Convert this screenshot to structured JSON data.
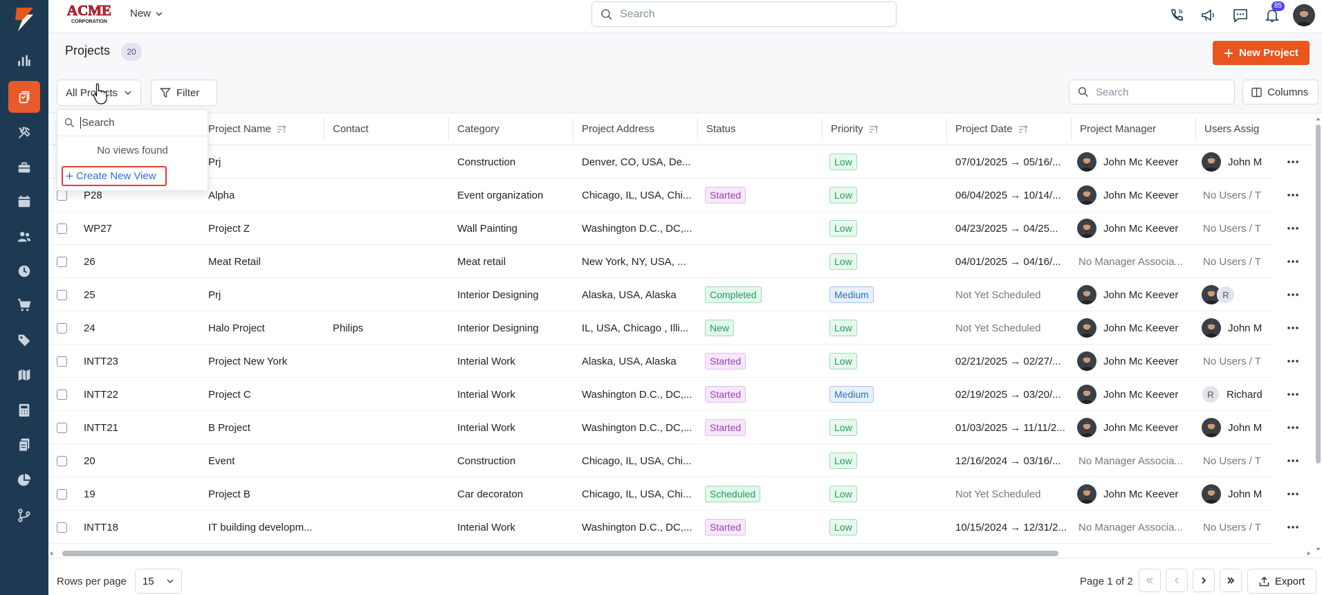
{
  "app": {
    "brand_name": "ACME",
    "brand_sub": "CORPORATION",
    "new_menu": "New",
    "search_placeholder": "Search",
    "notification_count": "85",
    "accent": "#e8551f",
    "sidebar_color": "#1e3a52"
  },
  "sidebar": {
    "items": [
      {
        "icon": "bar-chart-icon"
      },
      {
        "icon": "projects-icon",
        "active": true
      },
      {
        "icon": "tools-icon"
      },
      {
        "icon": "briefcase-icon"
      },
      {
        "icon": "calendar-icon"
      },
      {
        "icon": "users-icon"
      },
      {
        "icon": "clock-icon"
      },
      {
        "icon": "cart-icon"
      },
      {
        "icon": "tag-icon"
      },
      {
        "icon": "map-icon"
      },
      {
        "icon": "calculator-icon"
      },
      {
        "icon": "documents-icon"
      },
      {
        "icon": "pie-chart-icon"
      },
      {
        "icon": "workflow-icon"
      }
    ]
  },
  "page": {
    "title": "Projects",
    "count": "20",
    "new_project_label": "New Project"
  },
  "toolbar": {
    "view_label": "All Projects",
    "filter_label": "Filter",
    "search_placeholder": "Search",
    "columns_label": "Columns"
  },
  "views_dropdown": {
    "search_placeholder": "Search",
    "empty_text": "No views found",
    "create_label": "Create New View"
  },
  "table": {
    "columns": [
      "Project Name",
      "Contact",
      "Category",
      "Project Address",
      "Status",
      "Priority",
      "Project Date",
      "Project Manager",
      "Users Assig"
    ],
    "rows": [
      {
        "id": "",
        "name": "Prj",
        "contact": "",
        "category": "Construction",
        "address": "Denver, CO, USA, De...",
        "status": "",
        "priority": "Low",
        "date": "07/01/2025 → 05/16/...",
        "manager": "John Mc Keever",
        "users": "John M",
        "users_type": "avatar"
      },
      {
        "id": "P28",
        "name": "Alpha",
        "contact": "",
        "category": "Event organization",
        "address": "Chicago, IL, USA, Chi...",
        "status": "Started",
        "priority": "Low",
        "date": "06/04/2025 → 10/14/...",
        "manager": "John Mc Keever",
        "users": "No Users / T",
        "users_type": "none"
      },
      {
        "id": "WP27",
        "name": "Project Z",
        "contact": "",
        "category": "Wall Painting",
        "address": "Washington D.C., DC,...",
        "status": "",
        "priority": "Low",
        "date": "04/23/2025 → 04/25...",
        "manager": "John Mc Keever",
        "users": "No Users / T",
        "users_type": "none"
      },
      {
        "id": "26",
        "name": "Meat Retail",
        "contact": "",
        "category": "Meat retail",
        "address": "New York, NY, USA, ...",
        "status": "",
        "priority": "Low",
        "date": "04/01/2025 → 04/16/...",
        "manager": "No Manager Associa...",
        "users": "No Users / T",
        "users_type": "none"
      },
      {
        "id": "25",
        "name": "Prj",
        "contact": "",
        "category": "Interior Designing",
        "address": "Alaska, USA, Alaska",
        "status": "Completed",
        "priority": "Medium",
        "date": "Not Yet Scheduled",
        "manager": "John Mc Keever",
        "users": "R",
        "users_type": "stack"
      },
      {
        "id": "24",
        "name": "Halo Project",
        "contact": "Philips",
        "category": "Interior Designing",
        "address": "IL, USA, Chicago , Illi...",
        "status": "New",
        "priority": "Low",
        "date": "Not Yet Scheduled",
        "manager": "John Mc Keever",
        "users": "John M",
        "users_type": "avatar"
      },
      {
        "id": "INTT23",
        "name": "Project New York",
        "contact": "",
        "category": "Interial Work",
        "address": "Alaska, USA, Alaska",
        "status": "Started",
        "priority": "Low",
        "date": "02/21/2025 → 02/27/...",
        "manager": "John Mc Keever",
        "users": "No Users / T",
        "users_type": "none"
      },
      {
        "id": "INTT22",
        "name": "Project C",
        "contact": "",
        "category": "Interial Work",
        "address": "Washington D.C., DC,...",
        "status": "Started",
        "priority": "Medium",
        "date": "02/19/2025 → 03/20/...",
        "manager": "John Mc Keever",
        "users": "Richard",
        "users_type": "letter"
      },
      {
        "id": "INTT21",
        "name": "B Project",
        "contact": "",
        "category": "Interial Work",
        "address": "Washington D.C., DC,...",
        "status": "Started",
        "priority": "Low",
        "date": "01/03/2025 → 11/11/2...",
        "manager": "John Mc Keever",
        "users": "John M",
        "users_type": "avatar"
      },
      {
        "id": "20",
        "name": "Event",
        "contact": "",
        "category": "Construction",
        "address": "Chicago, IL, USA, Chi...",
        "status": "",
        "priority": "Low",
        "date": "12/16/2024 → 03/16/...",
        "manager": "No Manager Associa...",
        "users": "No Users / T",
        "users_type": "none"
      },
      {
        "id": "19",
        "name": "Project B",
        "contact": "",
        "category": "Car decoraton",
        "address": "Chicago, IL, USA, Chi...",
        "status": "Scheduled",
        "priority": "Low",
        "date": "Not Yet Scheduled",
        "manager": "John Mc Keever",
        "users": "John M",
        "users_type": "avatar"
      },
      {
        "id": "INTT18",
        "name": "IT building developm...",
        "contact": "",
        "category": "Interial Work",
        "address": "Washington D.C., DC,...",
        "status": "Started",
        "priority": "Low",
        "date": "10/15/2024 → 12/31/2...",
        "manager": "No Manager Associa...",
        "users": "No Users / T",
        "users_type": "none"
      }
    ]
  },
  "footer": {
    "rows_per_page_label": "Rows per page",
    "rows_per_page_value": "15",
    "page_info": "Page 1 of 2",
    "export_label": "Export"
  }
}
